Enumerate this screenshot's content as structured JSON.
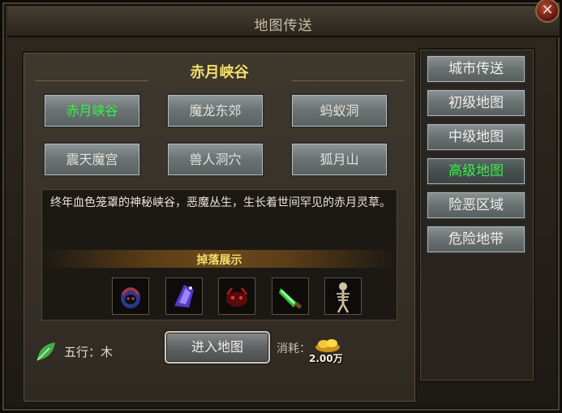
{
  "window": {
    "title": "地图传送",
    "close_glyph": "✕"
  },
  "selected_map": "赤月峡谷",
  "maps": [
    {
      "label": "赤月峡谷",
      "active": true
    },
    {
      "label": "魔龙东郊",
      "active": false
    },
    {
      "label": "蚂蚁洞",
      "active": false
    },
    {
      "label": "震天魔宫",
      "active": false
    },
    {
      "label": "兽人洞穴",
      "active": false
    },
    {
      "label": "狐月山",
      "active": false
    }
  ],
  "description": "终年血色笼罩的神秘峡谷，恶魔丛生，生长着世间罕见的赤月灵草。",
  "drops": {
    "title": "掉落展示",
    "items": [
      "helmet-icon",
      "crystal-icon",
      "demon-icon",
      "jade-blade-icon",
      "skeleton-icon"
    ]
  },
  "element": {
    "icon": "leaf-icon",
    "label": "五行：木"
  },
  "enter_button": "进入地图",
  "cost": {
    "label": "消耗：",
    "icon": "gold-pile-icon",
    "value": "2.00万"
  },
  "tabs": [
    {
      "label": "城市传送",
      "active": false
    },
    {
      "label": "初级地图",
      "active": false
    },
    {
      "label": "中级地图",
      "active": false
    },
    {
      "label": "高级地图",
      "active": true
    },
    {
      "label": "险恶区域",
      "active": false
    },
    {
      "label": "危险地带",
      "active": false
    }
  ],
  "colors": {
    "active_text": "#39f04c",
    "title_gold": "#f5df6a"
  }
}
